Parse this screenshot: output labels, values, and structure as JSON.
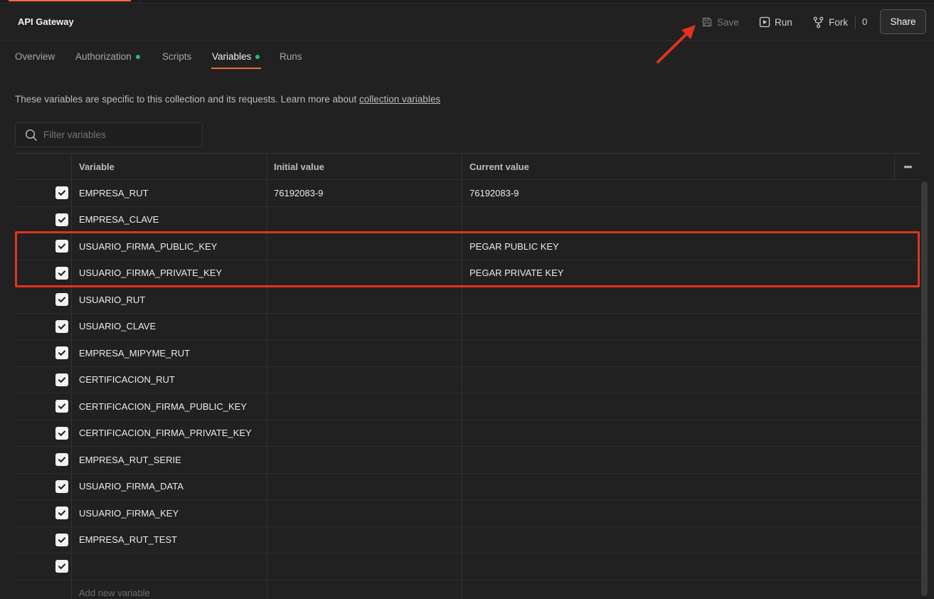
{
  "header": {
    "title": "API Gateway",
    "save_label": "Save",
    "run_label": "Run",
    "fork_label": "Fork",
    "fork_count": "0",
    "share_label": "Share"
  },
  "tabs": [
    {
      "label": "Overview",
      "dot": false,
      "active": false
    },
    {
      "label": "Authorization",
      "dot": true,
      "active": false
    },
    {
      "label": "Scripts",
      "dot": false,
      "active": false
    },
    {
      "label": "Variables",
      "dot": true,
      "active": true
    },
    {
      "label": "Runs",
      "dot": false,
      "active": false
    }
  ],
  "description": {
    "text": "These variables are specific to this collection and its requests. Learn more about ",
    "link": "collection variables"
  },
  "filter": {
    "placeholder": "Filter variables"
  },
  "table": {
    "headers": {
      "variable": "Variable",
      "initial": "Initial value",
      "current": "Current value",
      "more": "•••"
    },
    "rows": [
      {
        "checked": true,
        "variable": "EMPRESA_RUT",
        "initial": "76192083-9",
        "current": "76192083-9"
      },
      {
        "checked": true,
        "variable": "EMPRESA_CLAVE",
        "initial": "",
        "current": ""
      },
      {
        "checked": true,
        "variable": "USUARIO_FIRMA_PUBLIC_KEY",
        "initial": "",
        "current": "PEGAR PUBLIC KEY"
      },
      {
        "checked": true,
        "variable": "USUARIO_FIRMA_PRIVATE_KEY",
        "initial": "",
        "current": "PEGAR PRIVATE KEY"
      },
      {
        "checked": true,
        "variable": "USUARIO_RUT",
        "initial": "",
        "current": ""
      },
      {
        "checked": true,
        "variable": "USUARIO_CLAVE",
        "initial": "",
        "current": ""
      },
      {
        "checked": true,
        "variable": "EMPRESA_MIPYME_RUT",
        "initial": "",
        "current": ""
      },
      {
        "checked": true,
        "variable": "CERTIFICACION_RUT",
        "initial": "",
        "current": ""
      },
      {
        "checked": true,
        "variable": "CERTIFICACION_FIRMA_PUBLIC_KEY",
        "initial": "",
        "current": ""
      },
      {
        "checked": true,
        "variable": "CERTIFICACION_FIRMA_PRIVATE_KEY",
        "initial": "",
        "current": ""
      },
      {
        "checked": true,
        "variable": "EMPRESA_RUT_SERIE",
        "initial": "",
        "current": ""
      },
      {
        "checked": true,
        "variable": "USUARIO_FIRMA_DATA",
        "initial": "",
        "current": ""
      },
      {
        "checked": true,
        "variable": "USUARIO_FIRMA_KEY",
        "initial": "",
        "current": ""
      },
      {
        "checked": true,
        "variable": "EMPRESA_RUT_TEST",
        "initial": "",
        "current": ""
      },
      {
        "checked": true,
        "variable": "",
        "initial": "",
        "current": ""
      }
    ],
    "add_new_placeholder": "Add new variable"
  },
  "icons": {
    "save": "save-icon",
    "run": "play-icon",
    "fork": "fork-icon",
    "filter": "search-icon",
    "check": "checkmark-icon"
  },
  "colors": {
    "accent": "#f26b3a",
    "dot": "#1fc16b",
    "annotation": "#e2331e"
  }
}
